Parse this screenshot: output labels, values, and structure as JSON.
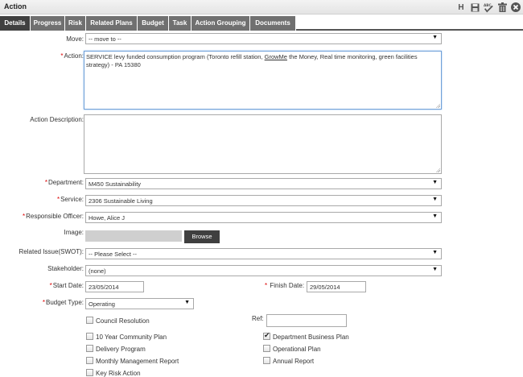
{
  "window": {
    "title": "Action"
  },
  "toolbar": {
    "icons": [
      "h-icon",
      "save-icon",
      "spellcheck-icon",
      "delete-icon",
      "close-icon"
    ]
  },
  "tabs": [
    {
      "label": "Details",
      "active": true
    },
    {
      "label": "Progress"
    },
    {
      "label": "Risk"
    },
    {
      "label": "Related Plans"
    },
    {
      "label": "Budget"
    },
    {
      "label": "Task"
    },
    {
      "label": "Action Grouping"
    },
    {
      "label": "Documents"
    }
  ],
  "form": {
    "move": {
      "label": "Move:",
      "value": "-- move to --"
    },
    "action": {
      "label": "Action:",
      "value_pre": "SERVICE levy funded consumption program (Toronto refill station, ",
      "value_link": "GrowMe",
      "value_post": " the Money, Real time monitoring, green facilities strategy) - PA 15380"
    },
    "action_description": {
      "label": "Action Description:",
      "value": ""
    },
    "department": {
      "label": "Department:",
      "value": "M450 Sustainability"
    },
    "service": {
      "label": "Service:",
      "value": "2306 Sustainable Living"
    },
    "responsible_officer": {
      "label": "Responsible Officer:",
      "value": "Howe, Alice J"
    },
    "image": {
      "label": "Image:",
      "browse_label": "Browse"
    },
    "related_issue": {
      "label": "Related Issue(SWOT):",
      "value": "-- Please Select --"
    },
    "stakeholder": {
      "label": "Stakeholder:",
      "value": "(none)"
    },
    "start_date": {
      "label": "Start Date:",
      "value": "23/05/2014"
    },
    "finish_date": {
      "label": "Finish Date:",
      "value": "29/05/2014"
    },
    "budget_type": {
      "label": "Budget Type:",
      "value": "Operating"
    },
    "ref": {
      "label": "Ref:",
      "value": ""
    },
    "checkboxes": {
      "council_resolution": {
        "label": "Council Resolution",
        "checked": false
      },
      "community_plan": {
        "label": "10 Year Community Plan",
        "checked": false
      },
      "delivery_program": {
        "label": "Delivery Program",
        "checked": false
      },
      "monthly_report": {
        "label": "Monthly Management Report",
        "checked": false
      },
      "key_risk": {
        "label": "Key Risk Action",
        "checked": false
      },
      "department_plan": {
        "label": "Department Business Plan",
        "checked": true
      },
      "operational_plan": {
        "label": "Operational Plan",
        "checked": false
      },
      "annual_report": {
        "label": "Annual Report",
        "checked": false
      }
    }
  }
}
